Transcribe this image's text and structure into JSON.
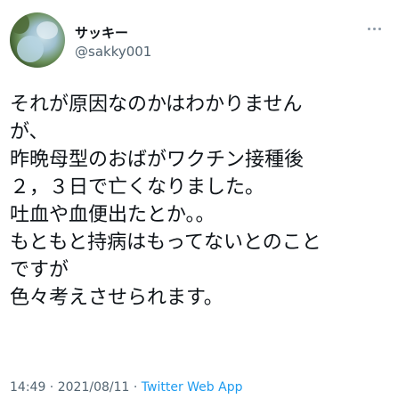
{
  "user": {
    "display_name": "サッキー",
    "handle": "@sakky001"
  },
  "icons": {
    "more": "more-horizontal-icon",
    "avatar": "profile-photo"
  },
  "tweet": {
    "lines": [
      "それが原因なのかはわかりません",
      "が、",
      "昨晩母型のおばがワクチン接種後",
      "２，３日で亡くなりました。",
      "吐血や血便出たとか。。",
      "もともと持病はもってないとのこと",
      "ですが",
      "色々考えさせられます。"
    ],
    "time": "14:49",
    "date": "2021/08/11",
    "separator": " · ",
    "source": "Twitter Web App"
  },
  "colors": {
    "text": "#0f1419",
    "secondary": "#536471",
    "link": "#1d9bf0"
  }
}
